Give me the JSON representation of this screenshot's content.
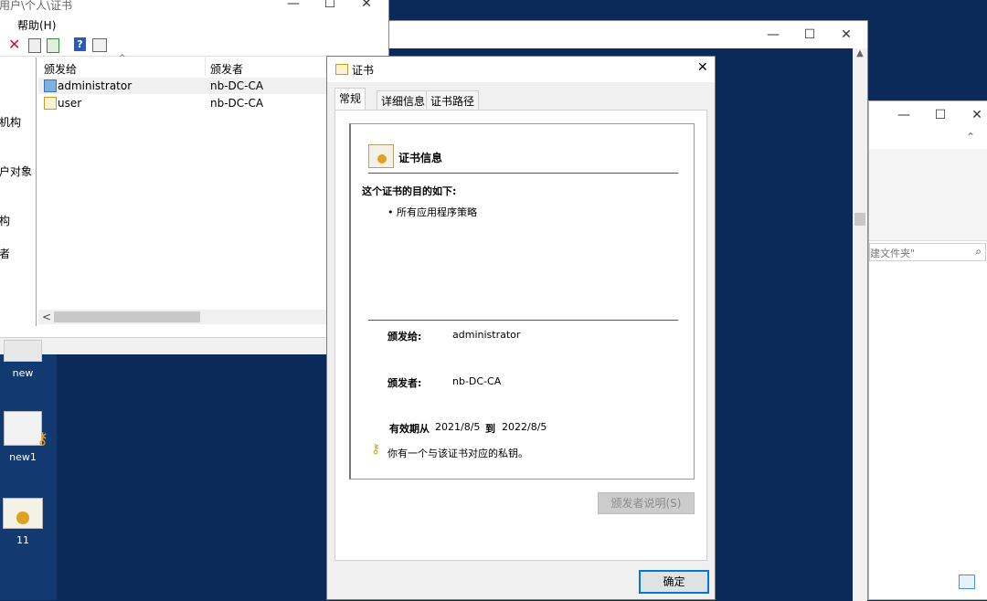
{
  "colors": {
    "desktop": "#0b2a5a",
    "window_bg": "#ffffff",
    "panel_bg": "#f0f0f0",
    "accent": "#0078d7"
  },
  "desktop": {
    "icons": [
      {
        "label": "new",
        "icon": "certificate-key-icon"
      },
      {
        "label": "new1",
        "icon": "letter-key-icon"
      },
      {
        "label": "11",
        "icon": "certificate-icon"
      }
    ]
  },
  "mmc_window": {
    "title": "用户\\个人\\证书",
    "menu_help": "帮助(H)",
    "left_items": [
      "机构",
      "户对象",
      "构",
      "者"
    ],
    "columns": [
      "颁发给",
      "颁发者"
    ],
    "rows": [
      {
        "issued_to": "administrator",
        "issued_by": "nb-DC-CA"
      },
      {
        "issued_to": "user",
        "issued_by": "nb-DC-CA"
      }
    ]
  },
  "right_window": {
    "search_placeholder": "建文件夹\""
  },
  "cert_dialog": {
    "title": "证书",
    "close": "✕",
    "tabs": [
      "常规",
      "详细信息",
      "证书路径"
    ],
    "header": "证书信息",
    "purpose_title": "这个证书的目的如下:",
    "purpose_item": "• 所有应用程序策略",
    "issued_to_label": "颁发给:",
    "issued_to_value": "administrator",
    "issued_by_label": "颁发者:",
    "issued_by_value": "nb-DC-CA",
    "valid_from_label": "有效期从",
    "valid_from": "2021/8/5",
    "valid_to_label": "到",
    "valid_to": "2022/8/5",
    "private_key_note": "你有一个与该证书对应的私钥。",
    "issuer_statement_button": "颁发者说明(S)",
    "ok_button": "确定"
  },
  "window_controls": {
    "minimize": "—",
    "maximize": "☐",
    "close": "✕"
  }
}
